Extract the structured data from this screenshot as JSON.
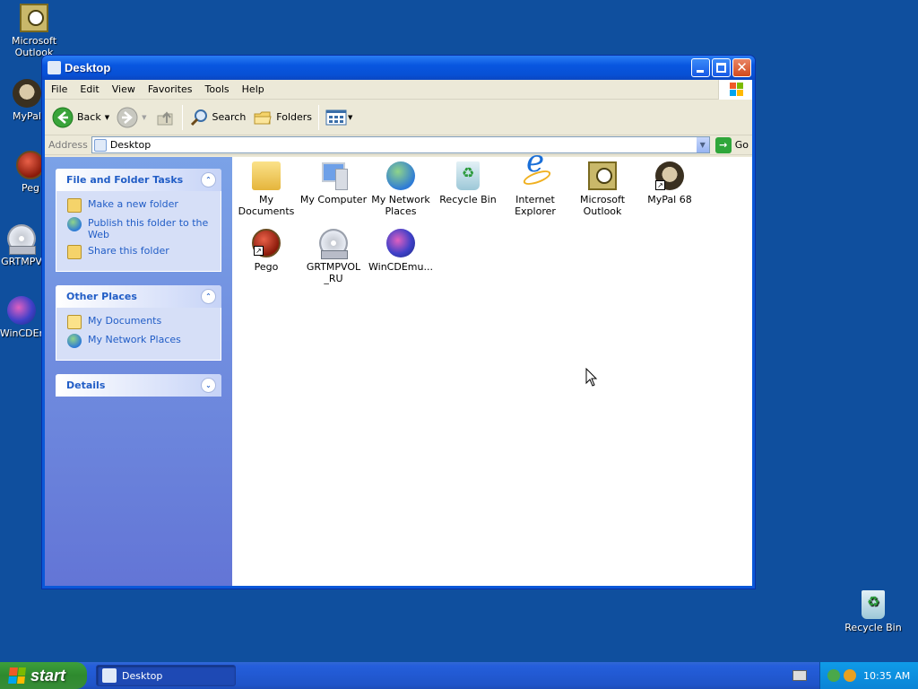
{
  "desktop": {
    "icons": [
      {
        "label": "Microsoft Outlook"
      },
      {
        "label": "MyPal"
      },
      {
        "label": "Peg"
      },
      {
        "label": "GRTMPV"
      },
      {
        "label": "WinCDEr"
      },
      {
        "label": "Recycle Bin"
      }
    ]
  },
  "window": {
    "title": "Desktop",
    "menu": [
      "File",
      "Edit",
      "View",
      "Favorites",
      "Tools",
      "Help"
    ],
    "toolbar": {
      "back": "Back",
      "search": "Search",
      "folders": "Folders"
    },
    "address": {
      "label": "Address",
      "value": "Desktop",
      "go": "Go"
    },
    "taskpane": {
      "file_tasks": {
        "title": "File and Folder Tasks",
        "items": [
          "Make a new folder",
          "Publish this folder to the Web",
          "Share this folder"
        ]
      },
      "other_places": {
        "title": "Other Places",
        "items": [
          "My Documents",
          "My Network Places"
        ]
      },
      "details": {
        "title": "Details"
      }
    },
    "files": [
      {
        "label": "My Documents",
        "icon": "folder-documents-icon"
      },
      {
        "label": "My Computer",
        "icon": "computer-icon"
      },
      {
        "label": "My Network Places",
        "icon": "network-places-icon"
      },
      {
        "label": "Recycle Bin",
        "icon": "recycle-bin-icon"
      },
      {
        "label": "Internet Explorer",
        "icon": "internet-explorer-icon"
      },
      {
        "label": "Microsoft Outlook",
        "icon": "outlook-icon"
      },
      {
        "label": "MyPal 68",
        "icon": "mypal-icon"
      },
      {
        "label": "Pego",
        "icon": "pego-icon"
      },
      {
        "label": "GRTMPVOL_RU",
        "icon": "cd-drive-icon"
      },
      {
        "label": "WinCDEmu...",
        "icon": "wincdemu-icon"
      }
    ]
  },
  "taskbar": {
    "start": "start",
    "task": "Desktop",
    "clock": "10:35 AM"
  }
}
